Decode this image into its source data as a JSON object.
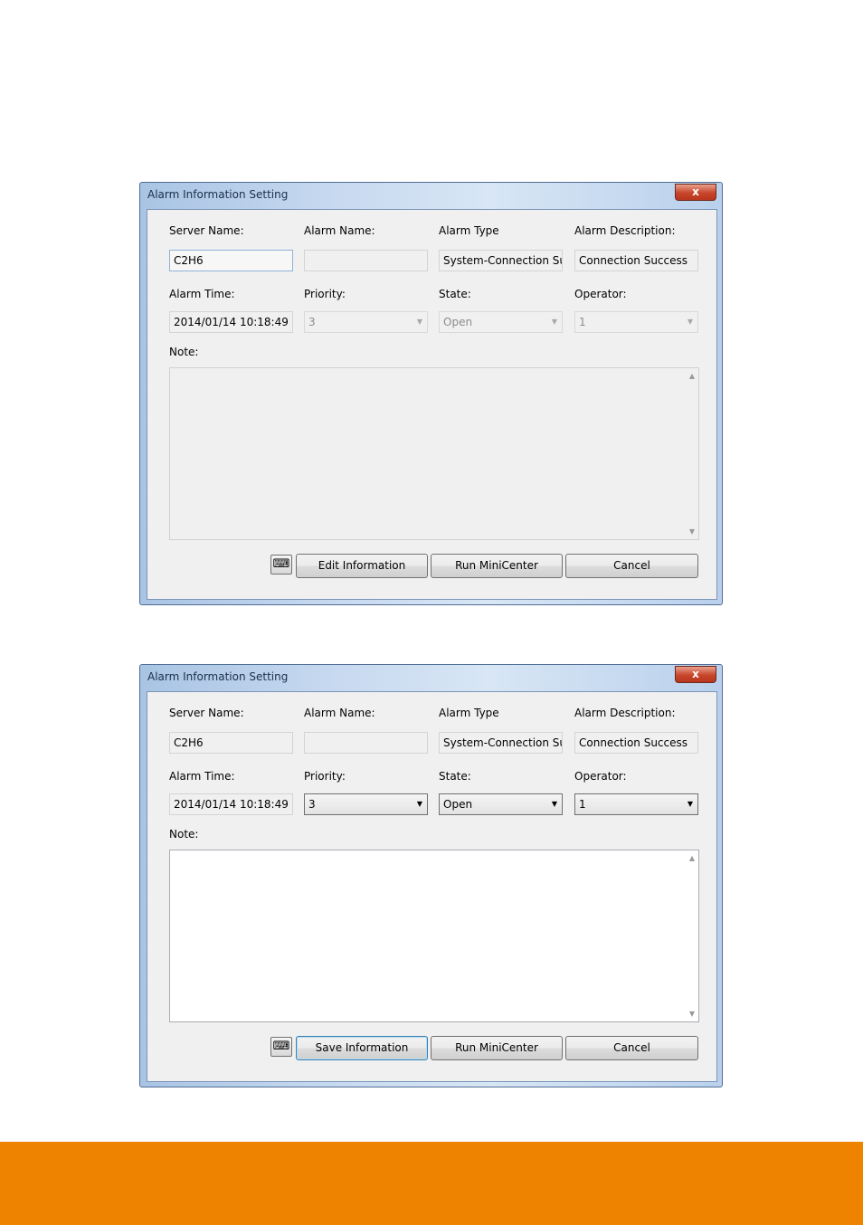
{
  "dialogs": [
    {
      "title": "Alarm Information Setting",
      "close_label": "x",
      "labels": {
        "server_name": "Server Name:",
        "alarm_name": "Alarm Name:",
        "alarm_type": "Alarm Type",
        "alarm_description": "Alarm Description:",
        "alarm_time": "Alarm Time:",
        "priority": "Priority:",
        "state": "State:",
        "operator": "Operator:",
        "note": "Note:"
      },
      "values": {
        "server_name": "C2H6",
        "alarm_name": "",
        "alarm_type": "System-Connection Su",
        "alarm_description": "Connection Success",
        "alarm_time": "2014/01/14 10:18:49",
        "priority": "3",
        "state": "Open",
        "operator": "1",
        "note": ""
      },
      "buttons": {
        "keyboard_icon": "keyboard-icon",
        "primary": "Edit Information",
        "run": "Run MiniCenter",
        "cancel": "Cancel"
      },
      "mode": "read-only"
    },
    {
      "title": "Alarm Information Setting",
      "close_label": "x",
      "labels": {
        "server_name": "Server Name:",
        "alarm_name": "Alarm Name:",
        "alarm_type": "Alarm Type",
        "alarm_description": "Alarm Description:",
        "alarm_time": "Alarm Time:",
        "priority": "Priority:",
        "state": "State:",
        "operator": "Operator:",
        "note": "Note:"
      },
      "values": {
        "server_name": "C2H6",
        "alarm_name": "",
        "alarm_type": "System-Connection Su",
        "alarm_description": "Connection Success",
        "alarm_time": "2014/01/14 10:18:49",
        "priority": "3",
        "state": "Open",
        "operator": "1",
        "note": ""
      },
      "buttons": {
        "keyboard_icon": "keyboard-icon",
        "primary": "Save Information",
        "run": "Run MiniCenter",
        "cancel": "Cancel"
      },
      "mode": "editable"
    }
  ],
  "colors": {
    "footer_band": "#ee8300",
    "client_bg": "#f0f0f0",
    "close_button": "#c7452b"
  }
}
